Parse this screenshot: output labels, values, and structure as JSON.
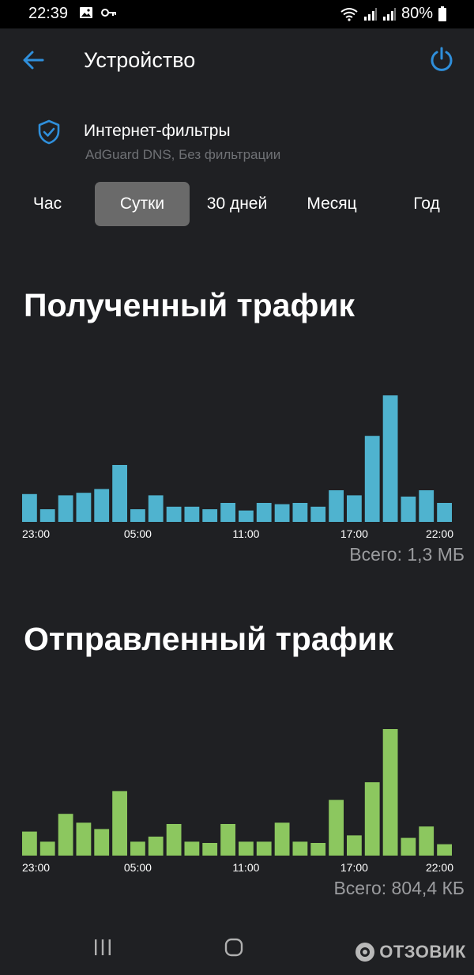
{
  "status_bar": {
    "time": "22:39",
    "battery": "80%",
    "icons": [
      "image-icon",
      "key-icon",
      "wifi-icon",
      "signal-icon",
      "signal-icon",
      "battery-icon"
    ]
  },
  "app_bar": {
    "title": "Устройство",
    "back_icon": "arrow-left-icon",
    "power_icon": "power-icon"
  },
  "filters": {
    "title": "Интернет-фильтры",
    "subtitle": "AdGuard DNS, Без фильтрации",
    "icon": "shield-check-icon"
  },
  "tabs": [
    {
      "label": "Час",
      "active": false
    },
    {
      "label": "Сутки",
      "active": true
    },
    {
      "label": "30 дней",
      "active": false
    },
    {
      "label": "Месяц",
      "active": false
    },
    {
      "label": "Год",
      "active": false
    }
  ],
  "colors": {
    "background": "#1f2023",
    "received": "#4fb3cf",
    "sent": "#8cc75f",
    "accent": "#2f8fdb",
    "tab_active": "#6a6a6a"
  },
  "received": {
    "title": "Полученный трафик",
    "total": "Всего: 1,3 МБ"
  },
  "sent": {
    "title": "Отправленный трафик",
    "total": "Всего: 804,4 КБ"
  },
  "chart_data": [
    {
      "type": "bar",
      "title": "Полученный трафик",
      "x_tick_labels": [
        "23:00",
        "05:00",
        "11:00",
        "17:00",
        "22:00"
      ],
      "x_tick_index": [
        0,
        6,
        12,
        18,
        23
      ],
      "values": [
        22,
        10,
        21,
        23,
        26,
        45,
        10,
        21,
        12,
        12,
        10,
        15,
        9,
        15,
        14,
        15,
        12,
        25,
        21,
        68,
        100,
        20,
        25,
        15
      ],
      "ylim": [
        0,
        100
      ],
      "grid": false,
      "legend": "none"
    },
    {
      "type": "bar",
      "title": "Отправленный трафик",
      "x_tick_labels": [
        "23:00",
        "05:00",
        "11:00",
        "17:00",
        "22:00"
      ],
      "x_tick_index": [
        0,
        6,
        12,
        18,
        23
      ],
      "values": [
        19,
        11,
        33,
        26,
        21,
        51,
        11,
        15,
        25,
        11,
        10,
        25,
        11,
        11,
        26,
        11,
        10,
        44,
        16,
        58,
        100,
        14,
        23,
        9
      ],
      "ylim": [
        0,
        100
      ],
      "grid": false,
      "legend": "none"
    }
  ],
  "nav_bar": {
    "icons": [
      "recents-icon",
      "home-icon"
    ]
  },
  "watermark": {
    "text": "ОТЗОВИК"
  }
}
